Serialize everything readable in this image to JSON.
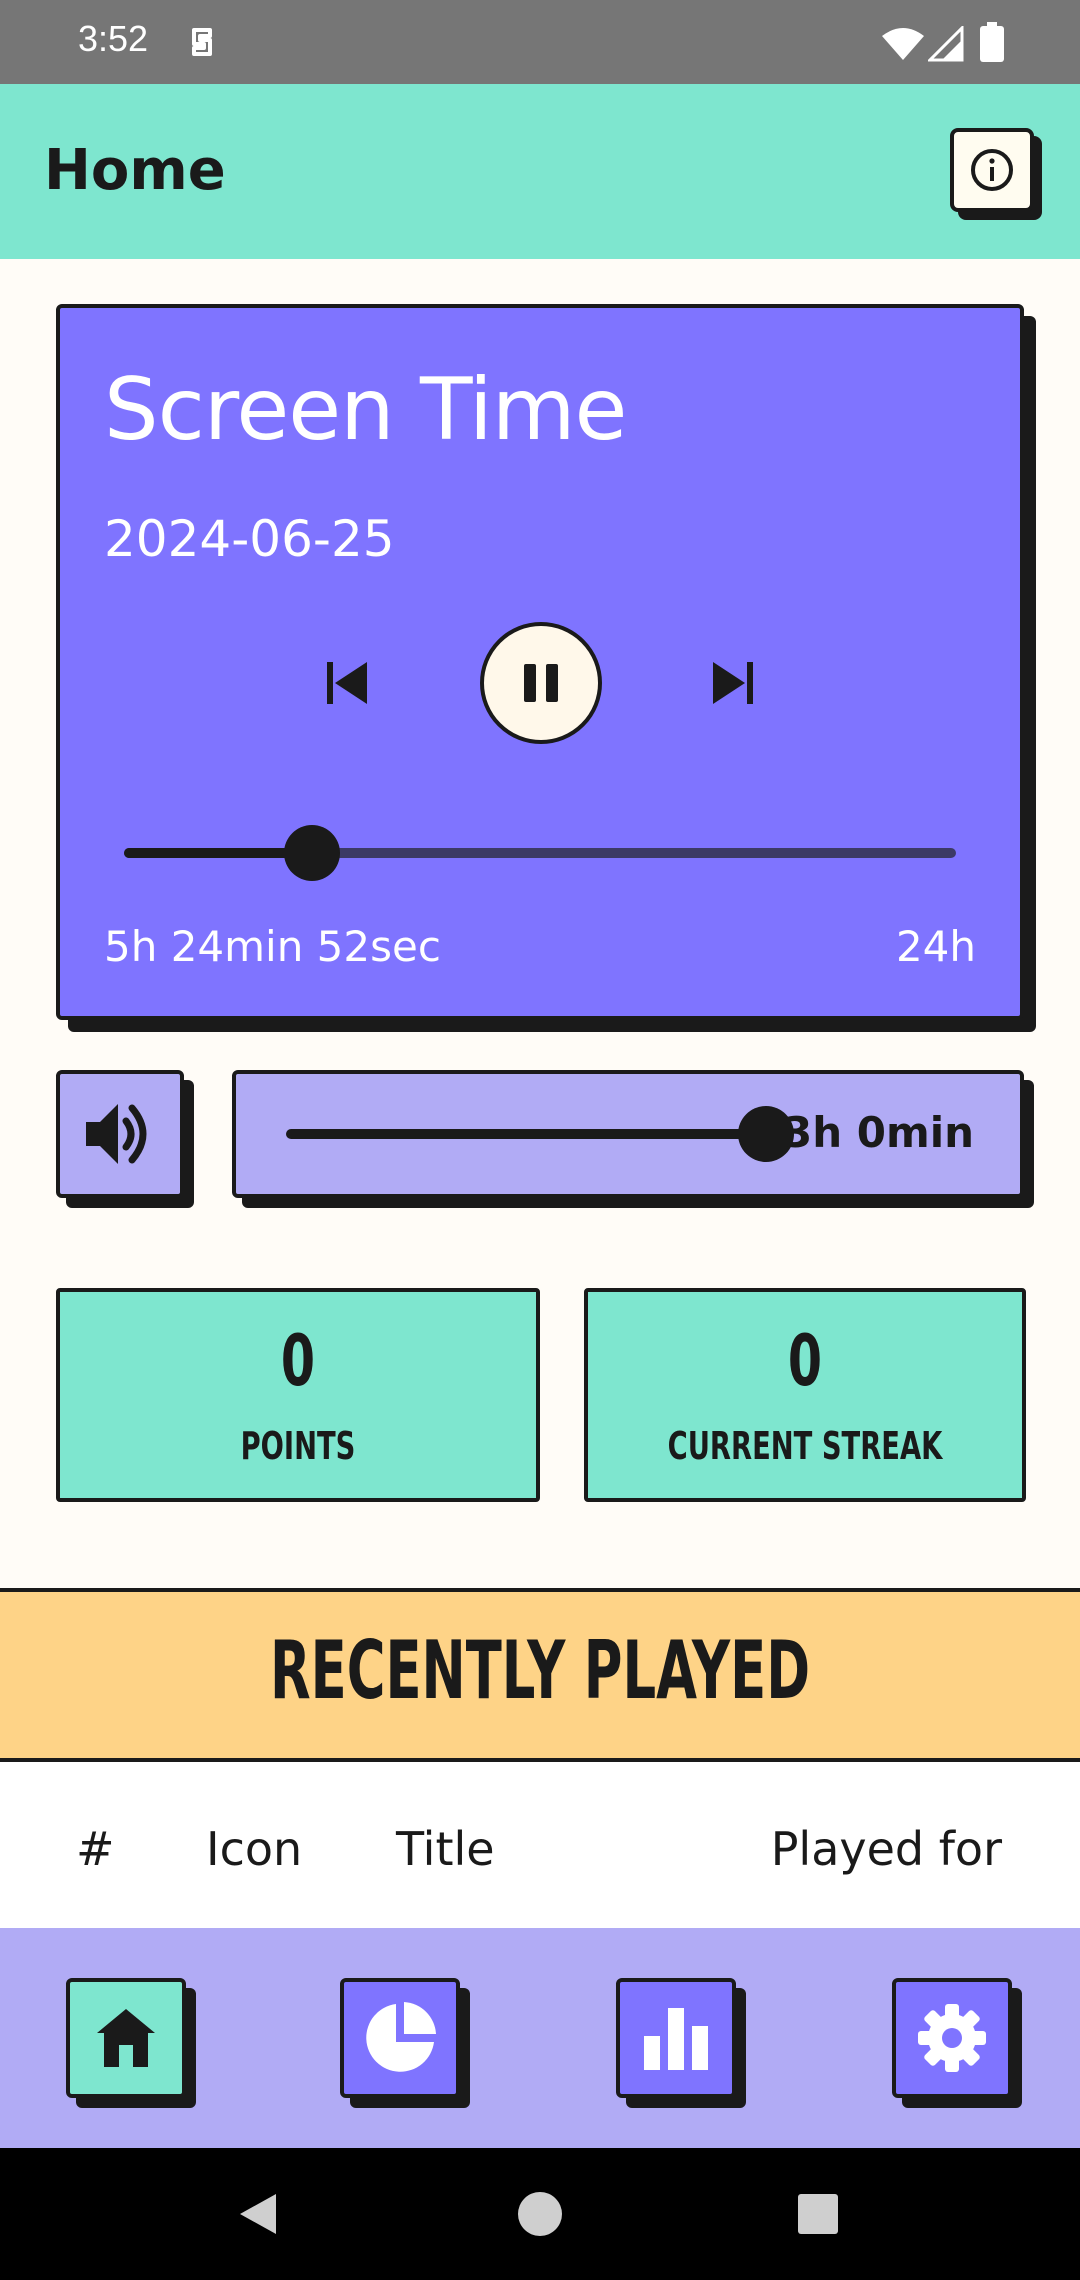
{
  "status_bar": {
    "time": "3:52"
  },
  "app_bar": {
    "title": "Home",
    "info_icon": "info-icon"
  },
  "screen_time_card": {
    "title": "Screen Time",
    "date": "2024-06-25",
    "progress_fraction": 0.226,
    "elapsed": "5h 24min 52sec",
    "total": "24h",
    "controls": [
      "skip-previous-icon",
      "pause-icon",
      "skip-next-icon"
    ],
    "color": "#7f74ff"
  },
  "limit": {
    "volume_icon": "volume-up-icon",
    "value_fraction": 1.0,
    "label": "3h 0min",
    "color": "#b1abf5"
  },
  "stats": {
    "points_value": "0",
    "points_label": "POINTS",
    "streak_value": "0",
    "streak_label": "CURRENT STREAK",
    "color": "#7ee6cf"
  },
  "recently_played": {
    "title": "RECENTLY PLAYED",
    "columns": [
      "#",
      "Icon",
      "Title",
      "Played for"
    ],
    "color": "#fed387"
  },
  "bottom_nav": {
    "items": [
      "home-icon",
      "pie-chart-icon",
      "bar-chart-icon",
      "settings-icon"
    ],
    "active": "home-icon"
  }
}
